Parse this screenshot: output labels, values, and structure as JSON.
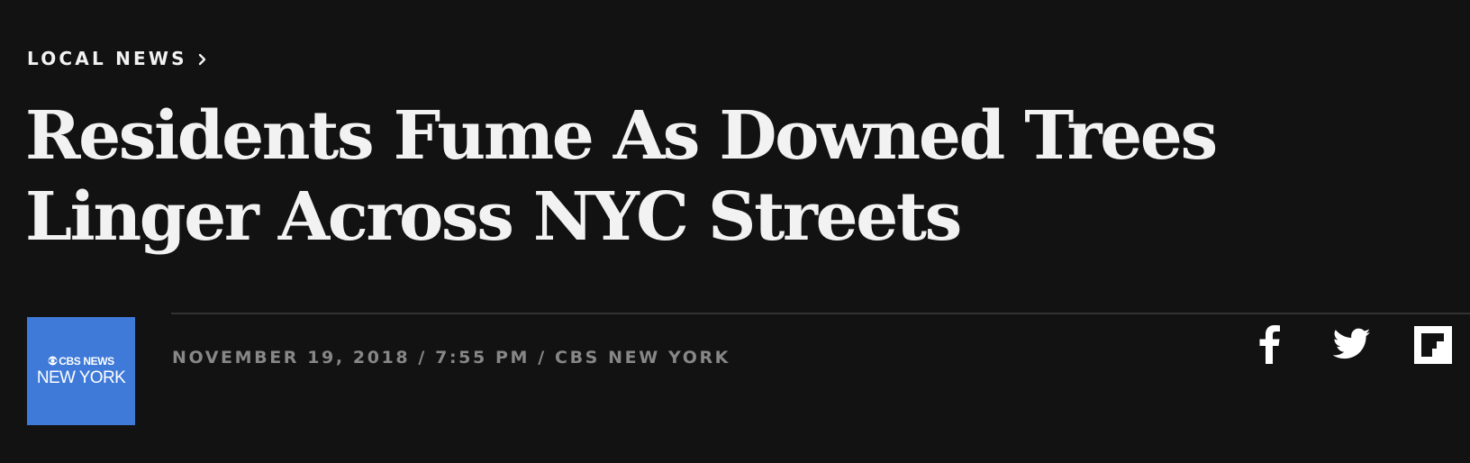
{
  "breadcrumb": {
    "label": "LOCAL NEWS",
    "chevron_icon": "chevron-right-icon"
  },
  "article": {
    "headline": "Residents Fume As Downed Trees Linger Across NYC Streets"
  },
  "source_logo": {
    "line1": "CBS NEWS",
    "line2": "NEW YORK",
    "background_color": "#3f7ad8",
    "icon": "cbs-eye-icon"
  },
  "meta": {
    "text": "NOVEMBER 19, 2018 / 7:55 PM / CBS NEW YORK"
  },
  "share": {
    "items": [
      {
        "icon": "facebook-icon"
      },
      {
        "icon": "twitter-icon"
      },
      {
        "icon": "flipboard-icon"
      }
    ]
  },
  "colors": {
    "background": "#121212",
    "headline": "#f2f2f2",
    "meta": "#878787",
    "divider": "#333333"
  }
}
